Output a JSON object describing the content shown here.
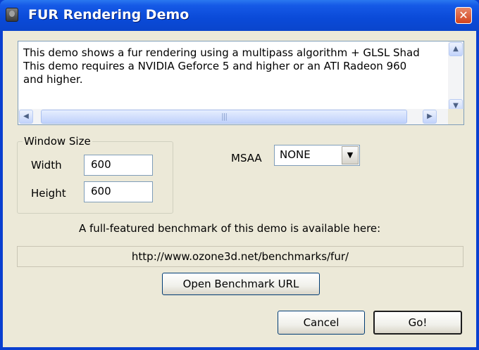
{
  "window": {
    "title": "FUR Rendering Demo",
    "close_glyph": "✕",
    "icon": "app-icon"
  },
  "description": {
    "lines": [
      "This demo shows a fur rendering using a multipass algorithm + GLSL Shad",
      "This demo requires a NVIDIA Geforce 5 and higher or an ATI Radeon 960",
      "and higher."
    ],
    "scroll_up_glyph": "▲",
    "scroll_down_glyph": "▼",
    "scroll_left_glyph": "◀",
    "scroll_right_glyph": "▶",
    "grip_glyph": "|||"
  },
  "window_size": {
    "legend": "Window Size",
    "width_label": "Width",
    "width_value": "600",
    "height_label": "Height",
    "height_value": "600"
  },
  "msaa": {
    "label": "MSAA",
    "selected": "NONE",
    "arrow_glyph": "▼"
  },
  "benchmark": {
    "info_text": "A full-featured benchmark of this demo is available here:",
    "url": "http://www.ozone3d.net/benchmarks/fur/",
    "open_button": "Open Benchmark URL"
  },
  "buttons": {
    "cancel": "Cancel",
    "go": "Go!"
  },
  "colors": {
    "titlebar": "#0a4ad8",
    "client_bg": "#ece9d8",
    "close_button": "#d2421c"
  }
}
